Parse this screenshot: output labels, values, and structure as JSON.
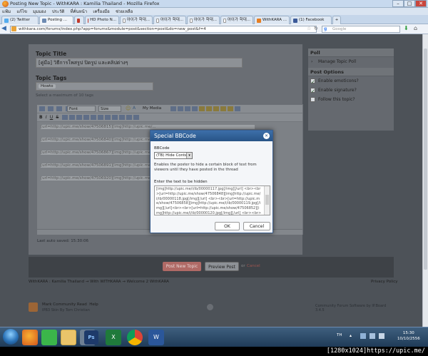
{
  "window": {
    "title": "Posting New Topic - WithKARA : Kamilia Thailand - Mozilla Firefox",
    "minimize": "–",
    "maximize": "□",
    "close": "✕"
  },
  "menu": [
    "แฟ้ม",
    "แก้ไข",
    "มุมมอง",
    "ประวัติ",
    "ที่คั่นหน้า",
    "เครื่องมือ",
    "ช่วยเหลือ"
  ],
  "tabs": [
    {
      "label": "(2) Twitter",
      "active": false,
      "color": "#55acee"
    },
    {
      "label": "Posting ...",
      "active": true,
      "color": "#6d8bb3"
    },
    {
      "label": "",
      "active": false,
      "color": "#c0392b"
    },
    {
      "label": "HD Photo N...",
      "active": false,
      "color": "#c0392b"
    },
    {
      "label": "아이가 학대...",
      "active": false,
      "color": "#999999"
    },
    {
      "label": "아이가 학대...",
      "active": false,
      "color": "#999999"
    },
    {
      "label": "아이가 학대...",
      "active": false,
      "color": "#999999"
    },
    {
      "label": "아이가 학대...",
      "active": false,
      "color": "#999999"
    },
    {
      "label": "WithKARA ...",
      "active": false,
      "color": "#e67e22"
    },
    {
      "label": "(1) Facebook",
      "active": false,
      "color": "#3b5998"
    }
  ],
  "nav": {
    "url": "withkara.com/forums/index.php?app=forums&module=post&section=post&do=new_post&f=4",
    "search_placeholder": "Google"
  },
  "form": {
    "topic_title_label": "Topic Title",
    "topic_title_value": "[คู่มือ] วิธีการโพสรูป ปิดรูป และคลิปต่างๆ",
    "topic_tags_label": "Topic Tags",
    "tag_value": "Howto",
    "tags_hint": "Select a maximum of 10 tags",
    "font_select": "Font",
    "size_select": "Size",
    "my_media": "My Media",
    "autosave": "Last auto saved: 15:30:06",
    "editor_lines": [
      "[url=http://upic.me/show/47506815][img]http://upic.me/...",
      "[url=http://upic.me/show/47506840][img]http://upic.me/...",
      "[url=http://upic.me/show/47506867][img]http://upic.me/...",
      "[url=http://upic.me/show/47506891][img]http://upic.me/...",
      "[url=http://upic.me/show/47506920][img]http://upic.me/..."
    ]
  },
  "sidebar": {
    "poll_header": "Poll",
    "manage_poll": "Manage Topic Poll",
    "options_header": "Post Options",
    "options": [
      {
        "label": "Enable emoticons?",
        "checked": true
      },
      {
        "label": "Enable signature?",
        "checked": true
      },
      {
        "label": "Follow this topic?",
        "checked": false
      }
    ]
  },
  "actions": {
    "post_button": "Post New Topic",
    "preview_button": "Preview Post",
    "or": "or",
    "cancel": "Cancel"
  },
  "breadcrumb": "WithKARA : Kamilia Thailand  → With WITHKARA  → Welcome 2 WithKARA",
  "privacy": "Privacy Policy",
  "footer": {
    "mark_read": "Mark Community Read",
    "help": "Help",
    "skin": "IPB3 Skin By Tom Christian",
    "powered": "Community Forum Software by IP.Board 3.4.5"
  },
  "dialog": {
    "title": "Special BBCode",
    "bbcode_label": "BBCode",
    "bbcode_selected": "(TB) Hide Content",
    "description": "Enables the poster to hide a certain block of text from viewers until they have posted in the thread",
    "text_label": "Enter the text to be hidden",
    "text_value": "[img]http://upic.me/i/ib/00000117.jpg[/img][/url] <br><br>[url=http://upic.me/show/47506848][img]http://upic.me/i/ib/00000118.jpg[/img][/url] <br><br>[url=http://upic.me/show/47506858][img]http://upic.me/i/ib/00000119.jpg[/img][/url]<br><br>[url=http://upic.me/show/47506852][img]http://upic.me/i/ib/00000120.jpg[/img][/url] <br><br>[url=http://upic.me",
    "ok": "OK",
    "cancel": "Cancel"
  },
  "taskbar": {
    "lang": "TH",
    "time": "15:30",
    "date": "10/10/2556"
  },
  "watermark": "[1280x1024]https://upic.me/"
}
